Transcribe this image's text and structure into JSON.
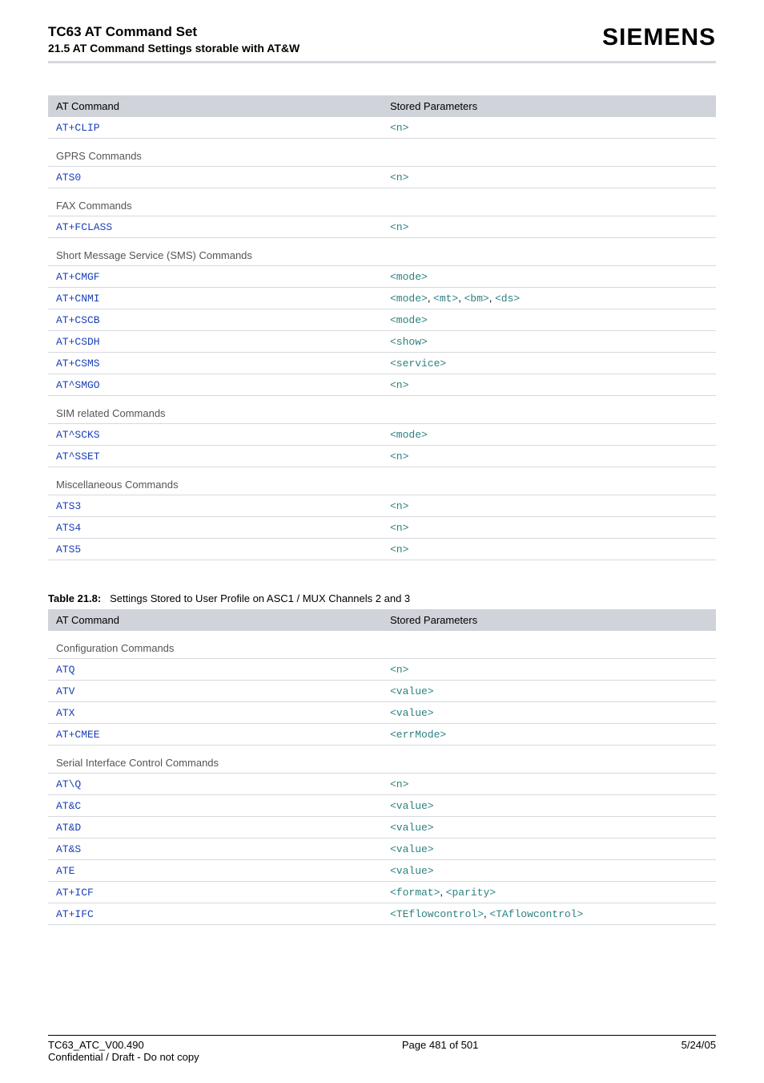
{
  "header": {
    "title1": "TC63 AT Command Set",
    "title2": "21.5 AT Command Settings storable with AT&W",
    "brand": "SIEMENS"
  },
  "table1": {
    "headers": [
      "AT Command",
      "Stored Parameters"
    ],
    "sections": [
      {
        "rows": [
          {
            "cmd": "AT+CLIP",
            "params": [
              "<n>"
            ]
          }
        ]
      },
      {
        "title": "GPRS Commands",
        "rows": [
          {
            "cmd": "ATS0",
            "params": [
              "<n>"
            ]
          }
        ]
      },
      {
        "title": "FAX Commands",
        "rows": [
          {
            "cmd": "AT+FCLASS",
            "params": [
              "<n>"
            ]
          }
        ]
      },
      {
        "title": "Short Message Service (SMS) Commands",
        "rows": [
          {
            "cmd": "AT+CMGF",
            "params": [
              "<mode>"
            ]
          },
          {
            "cmd": "AT+CNMI",
            "params": [
              "<mode>",
              "<mt>",
              "<bm>",
              "<ds>"
            ]
          },
          {
            "cmd": "AT+CSCB",
            "params": [
              "<mode>"
            ]
          },
          {
            "cmd": "AT+CSDH",
            "params": [
              "<show>"
            ]
          },
          {
            "cmd": "AT+CSMS",
            "params": [
              "<service>"
            ]
          },
          {
            "cmd": "AT^SMGO",
            "params": [
              "<n>"
            ]
          }
        ]
      },
      {
        "title": "SIM related Commands",
        "rows": [
          {
            "cmd": "AT^SCKS",
            "params": [
              "<mode>"
            ]
          },
          {
            "cmd": "AT^SSET",
            "params": [
              "<n>"
            ]
          }
        ]
      },
      {
        "title": "Miscellaneous Commands",
        "rows": [
          {
            "cmd": "ATS3",
            "params": [
              "<n>"
            ]
          },
          {
            "cmd": "ATS4",
            "params": [
              "<n>"
            ]
          },
          {
            "cmd": "ATS5",
            "params": [
              "<n>"
            ]
          }
        ]
      }
    ]
  },
  "caption": {
    "label": "Table 21.8:",
    "text": "Settings Stored to User Profile on ASC1 / MUX Channels 2 and 3"
  },
  "table2": {
    "headers": [
      "AT Command",
      "Stored Parameters"
    ],
    "sections": [
      {
        "title": "Configuration Commands",
        "rows": [
          {
            "cmd": "ATQ",
            "params": [
              "<n>"
            ]
          },
          {
            "cmd": "ATV",
            "params": [
              "<value>"
            ]
          },
          {
            "cmd": "ATX",
            "params": [
              "<value>"
            ]
          },
          {
            "cmd": "AT+CMEE",
            "params": [
              "<errMode>"
            ]
          }
        ]
      },
      {
        "title": "Serial Interface Control Commands",
        "rows": [
          {
            "cmd": "AT\\Q",
            "params": [
              "<n>"
            ]
          },
          {
            "cmd": "AT&C",
            "params": [
              "<value>"
            ]
          },
          {
            "cmd": "AT&D",
            "params": [
              "<value>"
            ]
          },
          {
            "cmd": "AT&S",
            "params": [
              "<value>"
            ]
          },
          {
            "cmd": "ATE",
            "params": [
              "<value>"
            ]
          },
          {
            "cmd": "AT+ICF",
            "params": [
              "<format>",
              "<parity>"
            ]
          },
          {
            "cmd": "AT+IFC",
            "params": [
              "<TEflowcontrol>",
              "<TAflowcontrol>"
            ]
          }
        ]
      }
    ]
  },
  "footer": {
    "left1": "TC63_ATC_V00.490",
    "left2": "Confidential / Draft - Do not copy",
    "center": "Page 481 of 501",
    "right": "5/24/05"
  }
}
